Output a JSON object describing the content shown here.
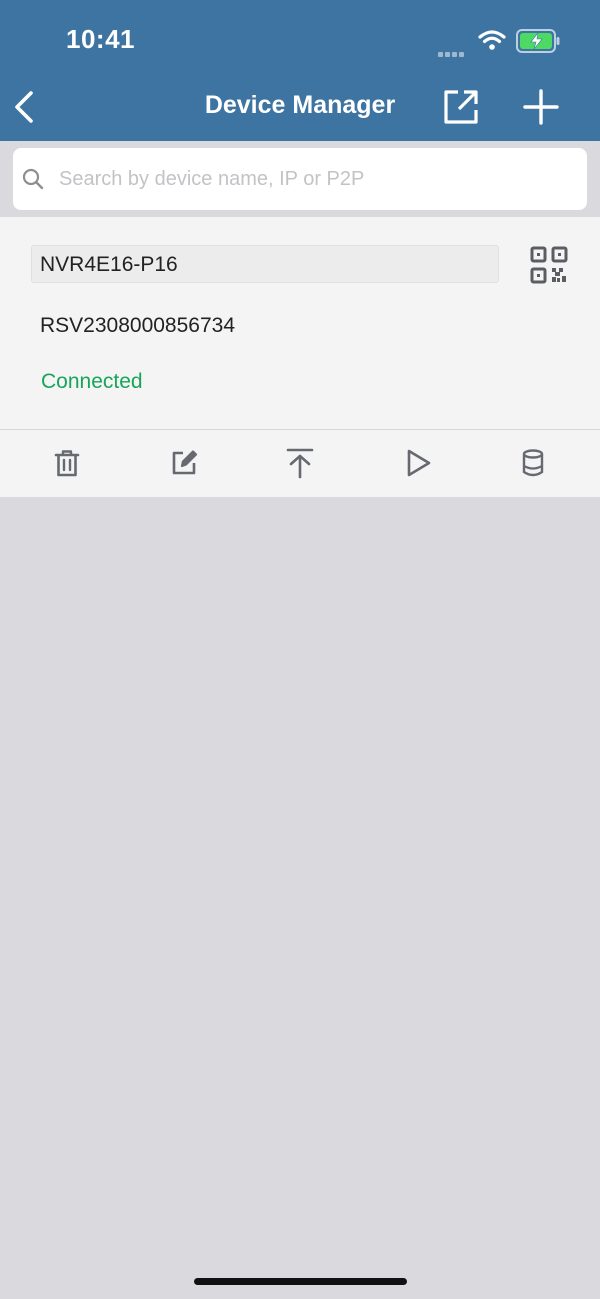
{
  "status_bar": {
    "time": "10:41",
    "icons": [
      "cellular-signal-icon",
      "wifi-icon",
      "battery-charging-icon"
    ]
  },
  "header": {
    "title": "Device Manager",
    "buttons": [
      "back-icon",
      "share-icon",
      "add-icon"
    ]
  },
  "search": {
    "placeholder": "Search by device name, IP or P2P",
    "value": ""
  },
  "device": {
    "name": "NVR4E16-P16",
    "serial": "RSV2308000856734",
    "status": "Connected"
  },
  "toolbar": {
    "actions": [
      "delete-icon",
      "edit-icon",
      "upload-icon",
      "play-icon",
      "storage-icon"
    ]
  },
  "colors": {
    "header_bg": "#3e74a1",
    "status_connected": "#18a55a",
    "page_bg": "#d9d9de",
    "card_bg": "#f4f4f4",
    "icon": "#666a70"
  }
}
